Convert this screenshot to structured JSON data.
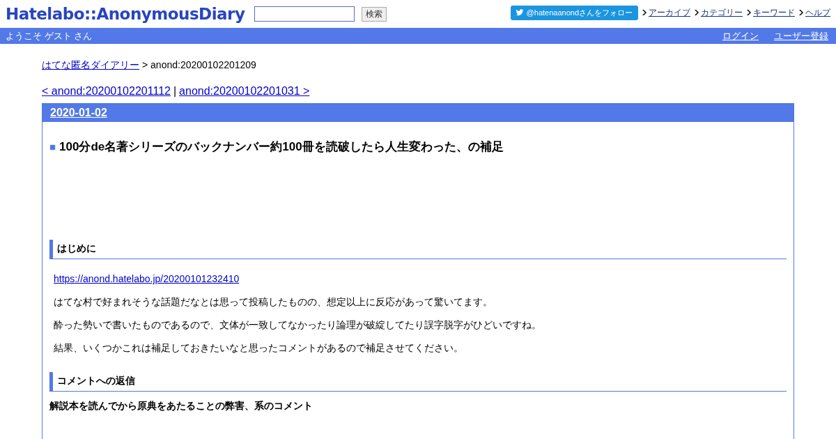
{
  "header": {
    "logo": "Hatelabo::AnonymousDiary",
    "search_button": "検索",
    "follow_button": "@hatenaanondさんをフォロー",
    "links": [
      "アーカイブ",
      "カテゴリー",
      "キーワード",
      "ヘルプ"
    ]
  },
  "user_bar": {
    "welcome": "ようこそ ゲスト さん",
    "links": [
      "ログイン",
      "ユーザー登録"
    ]
  },
  "breadcrumb": {
    "link": "はてな匿名ダイアリー",
    "current": "> anond:20200102201209"
  },
  "pager": {
    "prev": "< anond:20200102201112",
    "separator": "|",
    "next": "anond:20200102201031 >"
  },
  "day": {
    "date": "2020-01-02",
    "title_mark": "■",
    "title": "100分de名著シリーズのバックナンバー約100冊を読破したら人生変わった、の補足",
    "blocks": [
      {
        "kind": "heading",
        "text": "はじめに"
      },
      {
        "kind": "link",
        "text": "https://anond.hatelabo.jp/20200101232410"
      },
      {
        "kind": "paragraph",
        "text": "はてな村で好まれそうな話題だなとは思って投稿したものの、想定以上に反応があって驚いてます。"
      },
      {
        "kind": "paragraph",
        "text": "酔った勢いで書いたものであるので、文体が一致してなかったり論理が破綻してたり誤字脱字がひどいですね。"
      },
      {
        "kind": "paragraph",
        "text": "結果、いくつかこれは補足しておきたいなと思ったコメントがあるので補足させてください。"
      },
      {
        "kind": "heading",
        "text": "コメントへの返信"
      },
      {
        "kind": "subheading",
        "text": "解説本を読んでから原典をあたることの弊害、系のコメント"
      }
    ]
  }
}
